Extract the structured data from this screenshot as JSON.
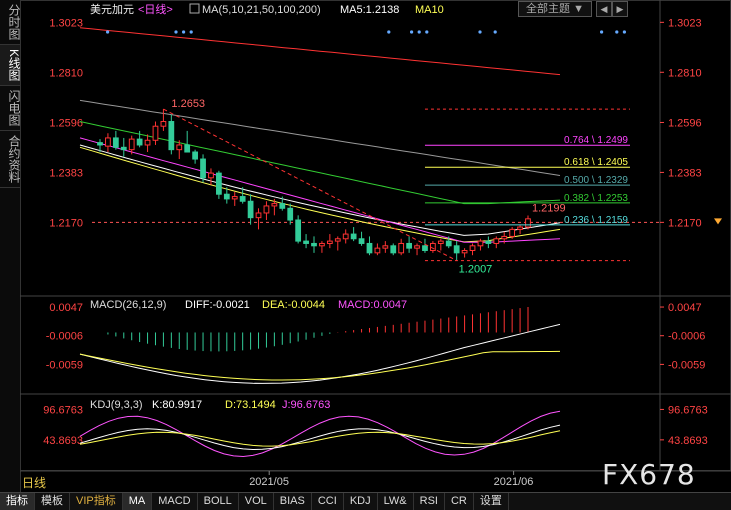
{
  "sidebar": {
    "tabs": [
      {
        "label": "分时图",
        "active": false
      },
      {
        "label": "K线图",
        "active": true
      },
      {
        "label": "闪电图",
        "active": false
      },
      {
        "label": "合约资料",
        "active": false
      }
    ]
  },
  "header": {
    "symbol": "美元加元",
    "period": "<日线>",
    "indicator": "MA(5,10,21,50,100,200)",
    "ma5_label": "MA5:1.2138",
    "ma10_label": "MA10",
    "menu": "全部主题",
    "menu_arrow": "▼",
    "prev": "◀",
    "next": "▶"
  },
  "macd_header": {
    "name": "MACD(26,12,9)",
    "diff": "DIFF:-0.0021",
    "dea": "DEA:-0.0044",
    "macd": "MACD:0.0047"
  },
  "kdj_header": {
    "name": "KDJ(9,3,3)",
    "k": "K:80.9917",
    "d": "D:73.1494",
    "j": "J:96.6763"
  },
  "bottom_tabs": [
    {
      "label": "指标",
      "active": true,
      "vip": false
    },
    {
      "label": "模板",
      "active": false,
      "vip": false
    },
    {
      "label": "VIP指标",
      "active": false,
      "vip": true
    },
    {
      "label": "MA",
      "active": true,
      "vip": false
    },
    {
      "label": "MACD",
      "active": false,
      "vip": false
    },
    {
      "label": "BOLL",
      "active": false,
      "vip": false
    },
    {
      "label": "VOL",
      "active": false,
      "vip": false
    },
    {
      "label": "BIAS",
      "active": false,
      "vip": false
    },
    {
      "label": "CCI",
      "active": false,
      "vip": false
    },
    {
      "label": "KDJ",
      "active": false,
      "vip": false
    },
    {
      "label": "LW&",
      "active": false,
      "vip": false
    },
    {
      "label": "RSI",
      "active": false,
      "vip": false
    },
    {
      "label": "CR",
      "active": false,
      "vip": false
    },
    {
      "label": "设置",
      "active": false,
      "vip": false
    }
  ],
  "dayline_label": "日线",
  "watermark": "FX678",
  "colors": {
    "up": "#ff3333",
    "down": "#33cc99",
    "axis": "#ff4444",
    "ma5": "#ffffff",
    "ma10": "#ffff55",
    "ma21": "#ff44ff",
    "ma50": "#33cc33",
    "ma100": "#999999",
    "ma200": "#ff3333",
    "macd_diff": "#ffffff",
    "macd_dea": "#ffff55"
  },
  "chart_data": {
    "type": "candlestick",
    "price_axis": {
      "ticks": [
        "1.3023",
        "1.2810",
        "1.2596",
        "1.2383",
        "1.2170"
      ],
      "ylim": [
        1.1873,
        1.305
      ]
    },
    "last_price": "1.2170",
    "x_axis": {
      "labels": [
        {
          "text": "2021/05",
          "index": 36
        },
        {
          "text": "2021/06",
          "index": 88
        }
      ]
    },
    "candles": [
      [
        1.251,
        1.2525,
        1.247,
        1.25
      ],
      [
        1.2495,
        1.255,
        1.247,
        1.253
      ],
      [
        1.253,
        1.256,
        1.248,
        1.249
      ],
      [
        1.249,
        1.253,
        1.245,
        1.248
      ],
      [
        1.248,
        1.254,
        1.246,
        1.2525
      ],
      [
        1.2525,
        1.256,
        1.249,
        1.25
      ],
      [
        1.25,
        1.2545,
        1.247,
        1.252
      ],
      [
        1.252,
        1.26,
        1.25,
        1.258
      ],
      [
        1.258,
        1.2653,
        1.256,
        1.26
      ],
      [
        1.26,
        1.263,
        1.246,
        1.248
      ],
      [
        1.248,
        1.252,
        1.244,
        1.25
      ],
      [
        1.25,
        1.256,
        1.248,
        1.247
      ],
      [
        1.247,
        1.248,
        1.242,
        1.244
      ],
      [
        1.244,
        1.246,
        1.234,
        1.236
      ],
      [
        1.236,
        1.24,
        1.233,
        1.238
      ],
      [
        1.238,
        1.239,
        1.227,
        1.229
      ],
      [
        1.229,
        1.232,
        1.225,
        1.227
      ],
      [
        1.227,
        1.23,
        1.224,
        1.228
      ],
      [
        1.228,
        1.232,
        1.225,
        1.226
      ],
      [
        1.226,
        1.229,
        1.216,
        1.219
      ],
      [
        1.219,
        1.223,
        1.214,
        1.221
      ],
      [
        1.221,
        1.226,
        1.218,
        1.224
      ],
      [
        1.224,
        1.227,
        1.22,
        1.225
      ],
      [
        1.225,
        1.228,
        1.222,
        1.223
      ],
      [
        1.223,
        1.225,
        1.216,
        1.218
      ],
      [
        1.218,
        1.22,
        1.208,
        1.209
      ],
      [
        1.209,
        1.212,
        1.206,
        1.208
      ],
      [
        1.208,
        1.211,
        1.204,
        1.207
      ],
      [
        1.207,
        1.209,
        1.204,
        1.208
      ],
      [
        1.208,
        1.212,
        1.206,
        1.209
      ],
      [
        1.209,
        1.211,
        1.205,
        1.21
      ],
      [
        1.21,
        1.214,
        1.208,
        1.212
      ],
      [
        1.212,
        1.215,
        1.209,
        1.21
      ],
      [
        1.21,
        1.213,
        1.207,
        1.208
      ],
      [
        1.208,
        1.211,
        1.203,
        1.204
      ],
      [
        1.204,
        1.208,
        1.203,
        1.206
      ],
      [
        1.206,
        1.209,
        1.204,
        1.207
      ],
      [
        1.207,
        1.208,
        1.203,
        1.204
      ],
      [
        1.204,
        1.21,
        1.203,
        1.208
      ],
      [
        1.208,
        1.211,
        1.204,
        1.206
      ],
      [
        1.206,
        1.208,
        1.203,
        1.207
      ],
      [
        1.207,
        1.21,
        1.204,
        1.205
      ],
      [
        1.205,
        1.209,
        1.204,
        1.208
      ],
      [
        1.208,
        1.21,
        1.205,
        1.209
      ],
      [
        1.209,
        1.211,
        1.206,
        1.207
      ],
      [
        1.207,
        1.209,
        1.2007,
        1.204
      ],
      [
        1.204,
        1.206,
        1.202,
        1.205
      ],
      [
        1.205,
        1.208,
        1.203,
        1.207
      ],
      [
        1.207,
        1.21,
        1.205,
        1.209
      ],
      [
        1.209,
        1.211,
        1.206,
        1.208
      ],
      [
        1.208,
        1.211,
        1.206,
        1.21
      ],
      [
        1.21,
        1.213,
        1.208,
        1.211
      ],
      [
        1.211,
        1.215,
        1.21,
        1.214
      ],
      [
        1.214,
        1.216,
        1.212,
        1.215
      ],
      [
        1.215,
        1.2199,
        1.214,
        1.2185
      ]
    ],
    "ma_lines": [
      {
        "name": "MA5",
        "color": "#ffffff",
        "start": 1.25,
        "end": 1.2138
      },
      {
        "name": "MA10",
        "color": "#ffff55",
        "start": 1.249,
        "end": 1.211
      },
      {
        "name": "MA21",
        "color": "#ff44ff",
        "start": 1.253,
        "end": 1.2085
      },
      {
        "name": "MA50",
        "color": "#33cc33",
        "start": 1.26,
        "end": 1.225
      },
      {
        "name": "MA100",
        "color": "#999999",
        "start": 1.269,
        "end": 1.237
      },
      {
        "name": "MA200",
        "color": "#ff3333",
        "start": 1.3,
        "end": 1.28
      }
    ],
    "high_label": "1.2653",
    "low_label": "1.2007",
    "last_high_label": "1.2199",
    "fib_levels": [
      {
        "ratio": "0.764",
        "price": 1.2499,
        "label": "0.764 \\ 1.2499",
        "color": "#ff44ff"
      },
      {
        "ratio": "0.618",
        "price": 1.2405,
        "label": "0.618 \\ 1.2405",
        "color": "#ffff55"
      },
      {
        "ratio": "0.500",
        "price": 1.2329,
        "label": "0.500 \\ 1.2329",
        "color": "#55aaaa"
      },
      {
        "ratio": "0.382",
        "price": 1.2253,
        "label": "0.382 \\ 1.2253",
        "color": "#33cc33"
      },
      {
        "ratio": "0.236",
        "price": 1.2159,
        "label": "0.236 \\ 1.2159",
        "color": "#55dddd"
      }
    ],
    "macd": {
      "ticks": [
        "0.0047",
        "-0.0006",
        "-0.0059"
      ],
      "ylim": [
        -0.011,
        0.006
      ],
      "diff_end": -0.0021,
      "dea_end": -0.0044,
      "macd_end": 0.0047
    },
    "kdj": {
      "ticks": [
        "96.6763",
        "43.8693"
      ],
      "ylim": [
        -5,
        120
      ],
      "k_end": 80.9917,
      "d_end": 73.1494,
      "j_end": 96.6763
    }
  }
}
